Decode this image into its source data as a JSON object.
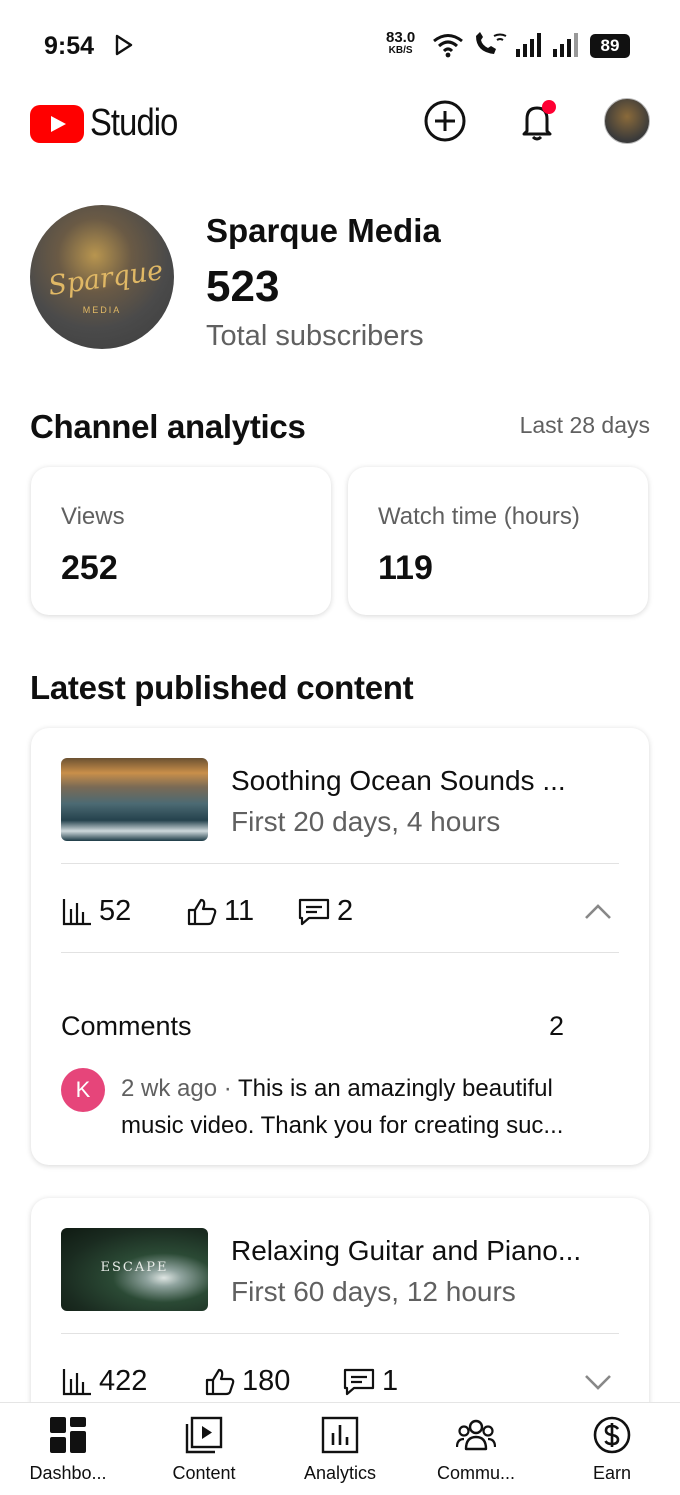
{
  "status_bar": {
    "time": "9:54",
    "net_speed": "83.0",
    "net_unit": "KB/S",
    "battery": "89",
    "icons": [
      "play-store-icon",
      "wifi-icon",
      "wifi-call-icon",
      "signal-icon",
      "signal-icon"
    ]
  },
  "header": {
    "logo_text": "Studio",
    "brand_color": "#ff0000",
    "icons": [
      "create-icon",
      "notification-bell-icon",
      "account-avatar"
    ]
  },
  "channel": {
    "name": "Sparque Media",
    "avatar_script": "Sparque",
    "avatar_sub": "MEDIA",
    "subscribers": "523",
    "subscribers_label": "Total subscribers"
  },
  "analytics": {
    "title": "Channel analytics",
    "range": "Last 28 days",
    "views_label": "Views",
    "views_value": "252",
    "watch_label": "Watch time (hours)",
    "watch_value": "119"
  },
  "latest": {
    "title": "Latest published content",
    "videos": [
      {
        "title": "Soothing Ocean Sounds ...",
        "period": "First 20 days, 4 hours",
        "views": "52",
        "likes": "11",
        "comments": "2",
        "expanded": true,
        "comments_section": {
          "heading": "Comments",
          "count": "2",
          "top_comment": {
            "initial": "K",
            "avatar_color": "#e6457a",
            "age": "2 wk ago",
            "separator": "·",
            "text": "This is an amazingly beautiful music video. Thank you for creating suc..."
          }
        }
      },
      {
        "title": "Relaxing Guitar and Piano...",
        "thumb_text": "ESCAPE",
        "period": "First 60 days, 12 hours",
        "views": "422",
        "likes": "180",
        "comments": "1",
        "expanded": false
      }
    ]
  },
  "bottom_nav": [
    {
      "label": "Dashbo...",
      "icon": "dashboard-icon"
    },
    {
      "label": "Content",
      "icon": "content-icon"
    },
    {
      "label": "Analytics",
      "icon": "analytics-icon"
    },
    {
      "label": "Commu...",
      "icon": "community-icon"
    },
    {
      "label": "Earn",
      "icon": "earn-icon"
    }
  ]
}
